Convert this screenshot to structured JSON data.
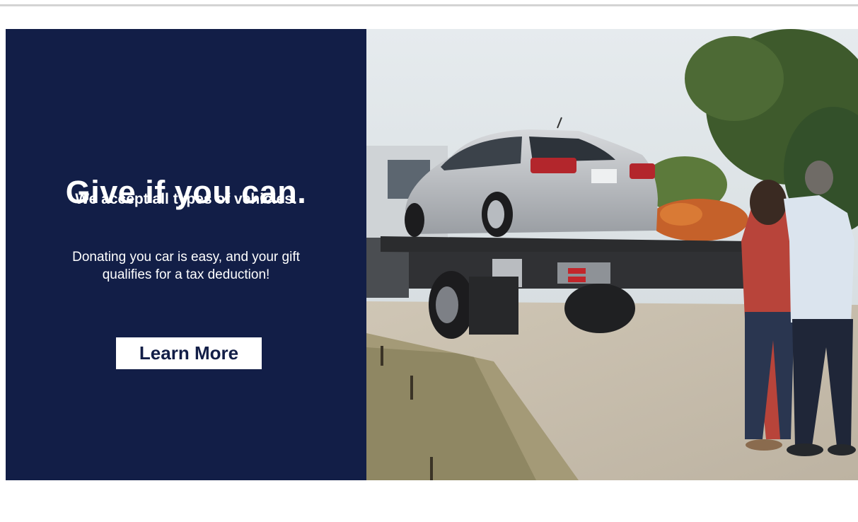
{
  "promo": {
    "headline": "Give if you can.",
    "subheadline": "We accept all types of vehicles.",
    "body": "Donating you car is easy, and your gift qualifies for a tax deduction!",
    "cta_label": "Learn More"
  },
  "colors": {
    "panel_background": "#121e47",
    "cta_background": "#ffffff",
    "cta_text": "#121e47"
  }
}
